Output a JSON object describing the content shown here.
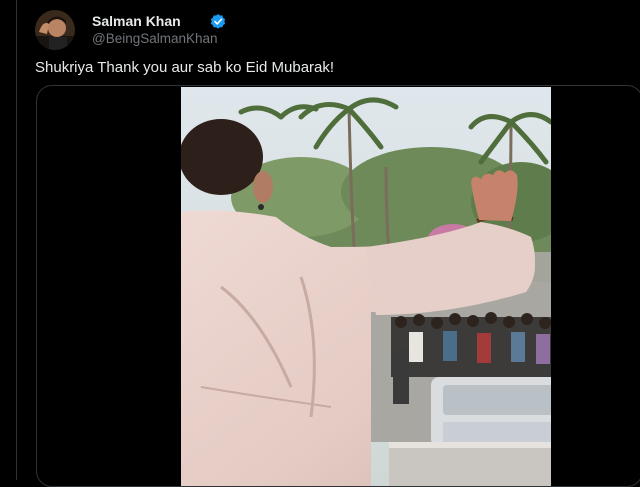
{
  "tweet": {
    "author_name": "Salman Khan",
    "author_handle": "@BeingSalmanKhan",
    "verified": true,
    "verified_color": "#1d9bf0",
    "text": "Shukriya Thank you aur sab ko Eid Mubarak!"
  },
  "media": {
    "type": "video",
    "subject": "man waving to crowd from balcony"
  },
  "colors": {
    "background": "#000000",
    "text_primary": "#e7e9ea",
    "text_secondary": "#71767b",
    "border": "#2f3336"
  }
}
